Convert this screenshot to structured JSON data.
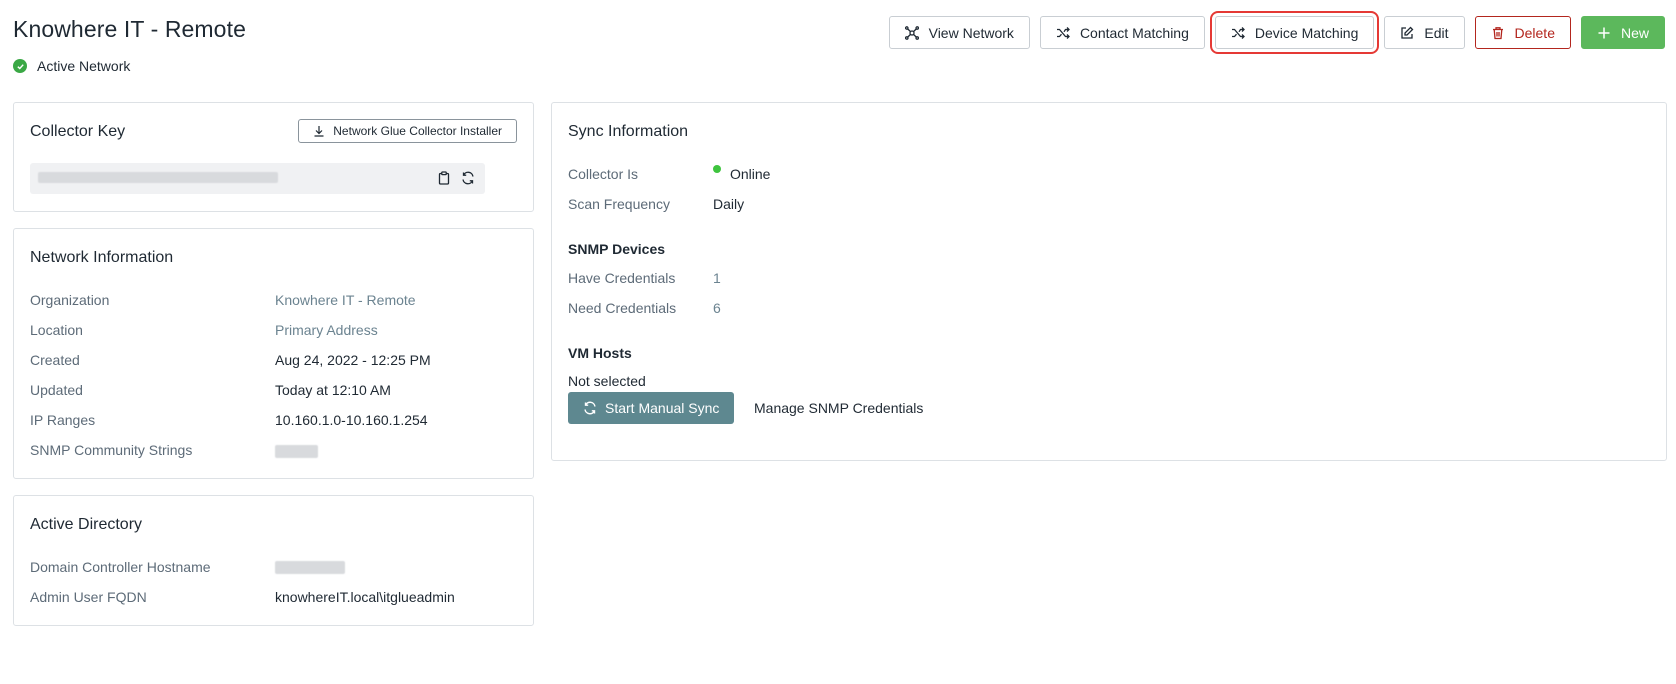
{
  "header": {
    "title": "Knowhere IT - Remote",
    "status": "Active Network"
  },
  "toolbar": {
    "view_network": "View Network",
    "contact_matching": "Contact Matching",
    "device_matching": "Device Matching",
    "edit": "Edit",
    "delete": "Delete",
    "new": "New"
  },
  "collector": {
    "title": "Collector Key",
    "installer_label": "Network Glue Collector Installer"
  },
  "network_info": {
    "title": "Network Information",
    "rows": [
      {
        "label": "Organization",
        "value": "Knowhere IT - Remote"
      },
      {
        "label": "Location",
        "value": "Primary Address"
      },
      {
        "label": "Created",
        "value": "Aug 24, 2022 - 12:25 PM"
      },
      {
        "label": "Updated",
        "value": "Today at 12:10 AM"
      },
      {
        "label": "IP Ranges",
        "value": "10.160.1.0-10.160.1.254"
      },
      {
        "label": "SNMP Community Strings",
        "value": ""
      }
    ]
  },
  "active_directory": {
    "title": "Active Directory",
    "rows": [
      {
        "label": "Domain Controller Hostname",
        "value": ""
      },
      {
        "label": "Admin User FQDN",
        "value": "knowhereIT.local\\itglueadmin"
      }
    ]
  },
  "sync": {
    "title": "Sync Information",
    "collector_label": "Collector Is",
    "collector_value": "Online",
    "frequency_label": "Scan Frequency",
    "frequency_value": "Daily",
    "snmp_heading": "SNMP Devices",
    "have_label": "Have Credentials",
    "have_value": "1",
    "need_label": "Need Credentials",
    "need_value": "6",
    "vm_heading": "VM Hosts",
    "vm_value": "Not selected",
    "start_sync": "Start Manual Sync",
    "manage_snmp": "Manage SNMP Credentials"
  },
  "colors": {
    "active_green": "#3aa845",
    "online_green": "#3ec43e",
    "new_button": "#5cb85c",
    "delete_red": "#b3261e",
    "sync_button": "#5e8890",
    "highlight_red": "#e53935"
  }
}
